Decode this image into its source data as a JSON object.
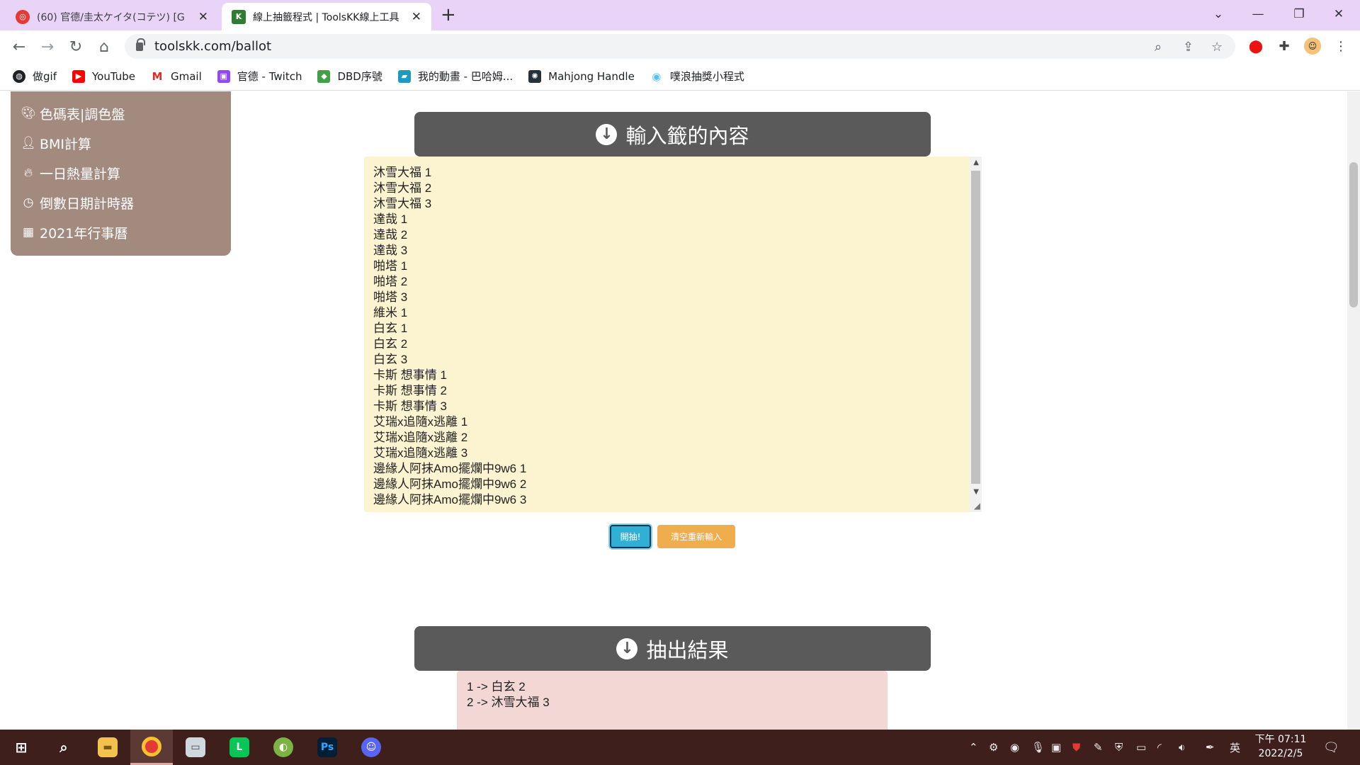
{
  "browser": {
    "tabs": [
      {
        "title": "(60) 官德/圭太ケイタ(コテツ) [G",
        "favicon": "opera-gx-icon"
      },
      {
        "title": "線上抽籤程式 | ToolsKK線上工具",
        "favicon": "toolskk-icon"
      }
    ],
    "url": "toolskk.com/ballot"
  },
  "bookmarks": [
    {
      "label": "做gif",
      "icon": "globe-icon",
      "color": "#202124"
    },
    {
      "label": "YouTube",
      "icon": "youtube-icon",
      "color": "#ff0000"
    },
    {
      "label": "Gmail",
      "icon": "gmail-icon",
      "color": "#d93025"
    },
    {
      "label": "官德 - Twitch",
      "icon": "twitch-icon",
      "color": "#9146ff"
    },
    {
      "label": "DBD序號",
      "icon": "dbd-icon",
      "color": "#2e7d32"
    },
    {
      "label": "我的動畫 - 巴哈姆...",
      "icon": "bahamut-icon",
      "color": "#1e9ac0"
    },
    {
      "label": "Mahjong Handle",
      "icon": "mahjong-icon",
      "color": "#263238"
    },
    {
      "label": "噗浪抽獎小程式",
      "icon": "plurk-icon",
      "color": "#4fc3f7"
    }
  ],
  "sidebar": {
    "items": [
      {
        "label": "色碼表|調色盤",
        "icon": "palette-icon"
      },
      {
        "label": "BMI計算",
        "icon": "user-icon"
      },
      {
        "label": "一日熱量計算",
        "icon": "flame-icon"
      },
      {
        "label": "倒數日期計時器",
        "icon": "clock-icon"
      },
      {
        "label": "2021年行事曆",
        "icon": "calendar-icon"
      }
    ]
  },
  "ballot": {
    "heading": "輸入籤的內容",
    "entries": [
      "沐雪大福 1",
      "沐雪大福 2",
      "沐雪大福 3",
      "達哉 1",
      "達哉 2",
      "達哉 3",
      "啪塔 1",
      "啪塔 2",
      "啪塔 3",
      "維米 1",
      "白玄 1",
      "白玄 2",
      "白玄 3",
      "卡斯 想事情 1",
      "卡斯 想事情 2",
      "卡斯 想事情 3",
      "艾瑞x追隨x逃離 1",
      "艾瑞x追隨x逃離 2",
      "艾瑞x追隨x逃離 3",
      "邊緣人阿抹Amo擺爛中9w6 1",
      "邊緣人阿抹Amo擺爛中9w6 2",
      "邊緣人阿抹Amo擺爛中9w6 3"
    ],
    "draw_label": "開抽!",
    "clear_label": "清空重新輸入",
    "draw_color": "#31b0d5",
    "clear_color": "#f0ad4e"
  },
  "result": {
    "heading": "抽出結果",
    "lines": [
      "1 -> 白玄 2",
      "2 -> 沐雪大福 3"
    ]
  },
  "taskbar": {
    "clock_period_time": "下午 07:11",
    "date": "2022/2/5",
    "ime": "英",
    "background": "#3e1f1c"
  }
}
